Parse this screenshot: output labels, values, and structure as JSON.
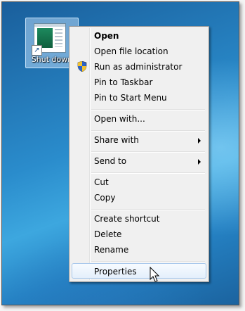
{
  "desktop": {
    "shortcut": {
      "label": "Shut down",
      "icon": "shortcut-app-icon"
    }
  },
  "context_menu": {
    "items": [
      {
        "label": "Open",
        "bold": true
      },
      {
        "label": "Open file location"
      },
      {
        "label": "Run as administrator",
        "icon": "uac-shield-icon"
      },
      {
        "label": "Pin to Taskbar"
      },
      {
        "label": "Pin to Start Menu"
      },
      {
        "label": "Open with..."
      },
      {
        "label": "Share with",
        "submenu": true
      },
      {
        "label": "Send to",
        "submenu": true
      },
      {
        "label": "Cut"
      },
      {
        "label": "Copy"
      },
      {
        "label": "Create shortcut"
      },
      {
        "label": "Delete"
      },
      {
        "label": "Rename"
      },
      {
        "label": "Properties",
        "hovered": true
      }
    ]
  },
  "colors": {
    "menu_bg": "#f0f0f0",
    "hover_border": "#a9c9ec",
    "desktop": "#2a8ccc"
  }
}
